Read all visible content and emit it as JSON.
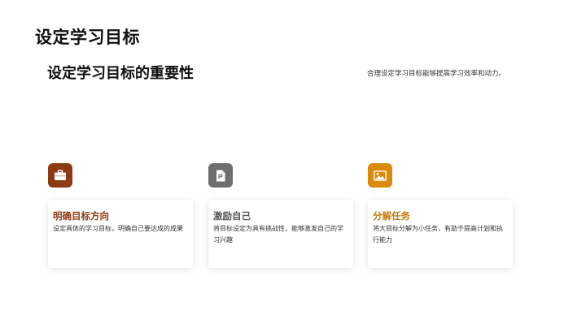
{
  "slide": {
    "title": "设定学习目标",
    "subtitle": "设定学习目标的重要性",
    "intro": "合理设定学习目标能够提高学习效率和动力。"
  },
  "cards": [
    {
      "title": "明确目标方向",
      "text": "设定具体的学习目标，明确自己要达成的成果",
      "title_color": "#8B3A12",
      "icon": "briefcase-icon",
      "icon_color": "#8B3A12"
    },
    {
      "title": "激励自己",
      "text": "将目标设定为具有挑战性，能够激发自己的学习兴趣",
      "title_color": "#555555",
      "icon": "document-icon",
      "icon_color": "#6E6E6E"
    },
    {
      "title": "分解任务",
      "text": "将大目标分解为小任务，有助于提高计划和执行能力",
      "title_color": "#C77A0A",
      "icon": "image-icon",
      "icon_color": "#D98A0B"
    }
  ]
}
